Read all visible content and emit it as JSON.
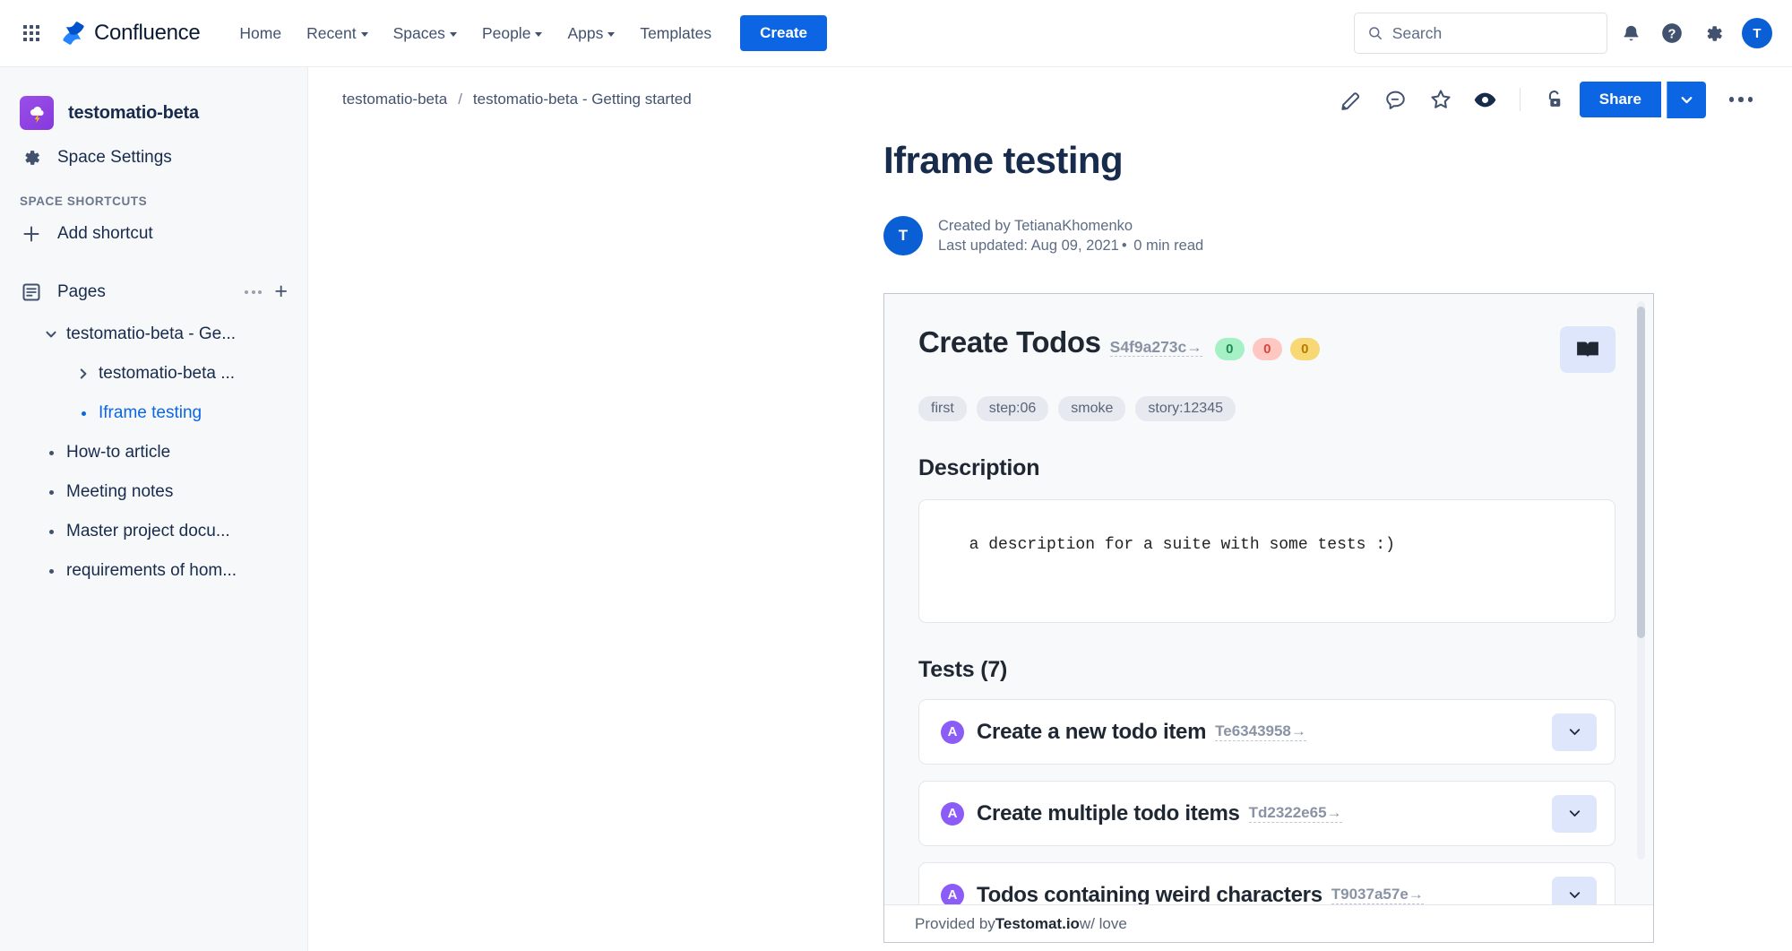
{
  "topnav": {
    "brand": "Confluence",
    "items": [
      {
        "label": "Home",
        "has_caret": false
      },
      {
        "label": "Recent",
        "has_caret": true
      },
      {
        "label": "Spaces",
        "has_caret": true
      },
      {
        "label": "People",
        "has_caret": true
      },
      {
        "label": "Apps",
        "has_caret": true
      },
      {
        "label": "Templates",
        "has_caret": false
      }
    ],
    "create_label": "Create",
    "search_placeholder": "Search",
    "avatar_initial": "T",
    "icons": [
      "apps-grid-icon",
      "search-icon",
      "notifications-bell-icon",
      "help-icon",
      "settings-gear-icon"
    ]
  },
  "sidebar": {
    "space_name": "testomatio-beta",
    "space_settings_label": "Space Settings",
    "shortcuts_header": "SPACE SHORTCUTS",
    "add_shortcut_label": "Add shortcut",
    "pages_label": "Pages",
    "tree": [
      {
        "label": "testomatio-beta - Ge...",
        "level": 0,
        "marker": "chevron-down",
        "selected": false
      },
      {
        "label": "testomatio-beta ...",
        "level": 1,
        "marker": "chevron-right",
        "selected": false
      },
      {
        "label": "Iframe testing",
        "level": 1,
        "marker": "bullet",
        "selected": true
      },
      {
        "label": "How-to article",
        "level": 0,
        "marker": "bullet",
        "selected": false
      },
      {
        "label": "Meeting notes",
        "level": 0,
        "marker": "bullet",
        "selected": false
      },
      {
        "label": "Master project docu...",
        "level": 0,
        "marker": "bullet",
        "selected": false
      },
      {
        "label": "requirements of hom...",
        "level": 0,
        "marker": "bullet",
        "selected": false
      }
    ]
  },
  "breadcrumb": {
    "items": [
      "testomatio-beta",
      "testomatio-beta - Getting started"
    ],
    "separator": "/"
  },
  "page_actions": {
    "share_label": "Share",
    "icons": [
      "edit-pencil-icon",
      "comment-icon",
      "star-icon",
      "watch-eye-icon",
      "unlock-icon",
      "more-actions-icon"
    ]
  },
  "page": {
    "title": "Iframe testing",
    "avatar_initial": "T",
    "created_by": "Created by TetianaKhomenko",
    "last_updated": "Last updated: Aug 09, 2021",
    "separator": "•",
    "read_time": "0 min read"
  },
  "embed": {
    "suite_title": "Create Todos",
    "suite_id": "S4f9a273c→",
    "pills": [
      {
        "value": "0",
        "color": "#A6F0C6",
        "status": "passed"
      },
      {
        "value": "0",
        "color": "#FFC7C2",
        "status": "failed"
      },
      {
        "value": "0",
        "color": "#F8D775",
        "status": "skipped"
      }
    ],
    "tags": [
      "first",
      "step:06",
      "smoke",
      "story:12345"
    ],
    "description_heading": "Description",
    "description_text": "  a description for a suite with some tests :)",
    "tests_heading": "Tests (7)",
    "tests": [
      {
        "badge": "A",
        "name": "Create a new todo item",
        "id": "Te6343958→"
      },
      {
        "badge": "A",
        "name": "Create multiple todo items",
        "id": "Td2322e65→"
      },
      {
        "badge": "A",
        "name": "Todos containing weird characters",
        "id": "T9037a57e→"
      }
    ],
    "footer_prefix": "Provided by ",
    "footer_brand": "Testomat.io",
    "footer_suffix": " w/ love"
  }
}
